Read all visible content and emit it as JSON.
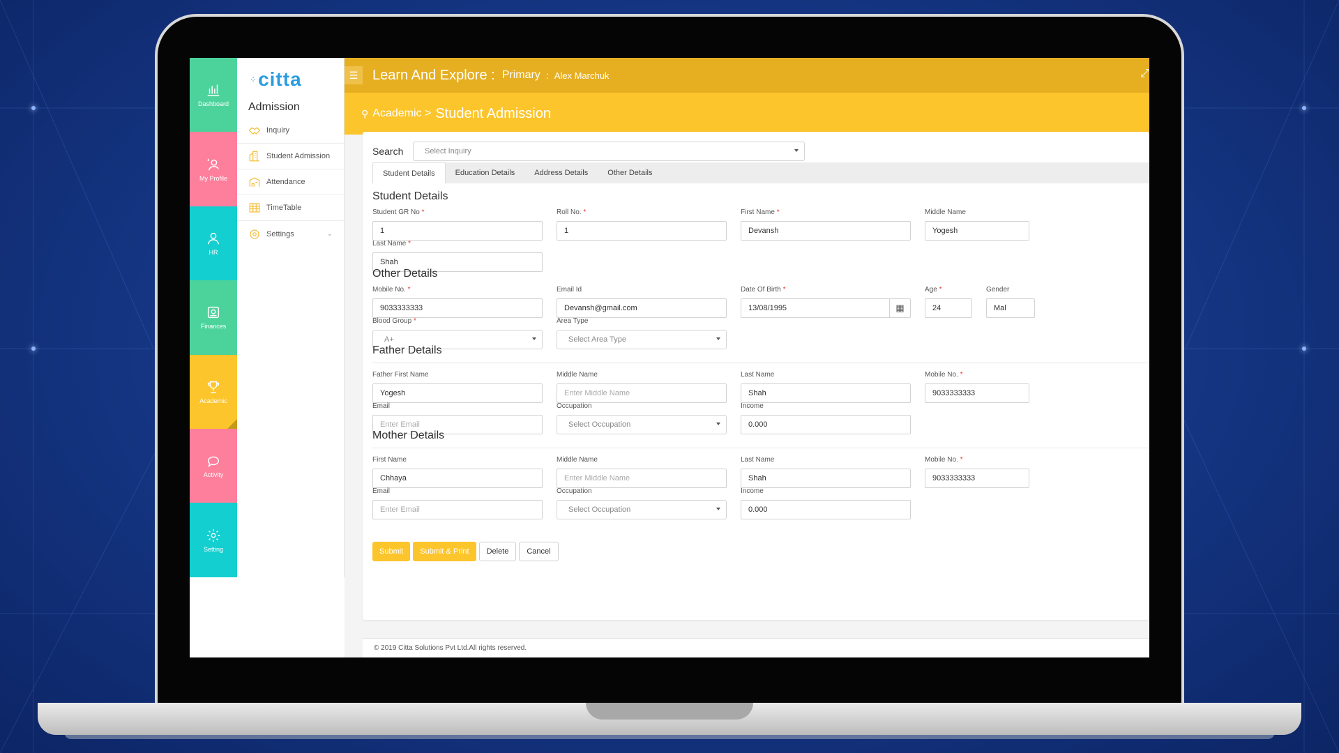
{
  "rail": [
    {
      "label": "Dashboard",
      "icon": "bar-chart-icon",
      "color": "#4cd39b"
    },
    {
      "label": "My Profile",
      "icon": "profile-icon",
      "color": "#fd7f9c"
    },
    {
      "label": "HR",
      "icon": "person-icon",
      "color": "#13cfd0"
    },
    {
      "label": "Finances",
      "icon": "finance-icon",
      "color": "#4cd39b"
    },
    {
      "label": "Academic",
      "icon": "trophy-icon",
      "color": "#fcc52c"
    },
    {
      "label": "Activity",
      "icon": "chat-icon",
      "color": "#fd7f9c"
    },
    {
      "label": "Setting",
      "icon": "gear-icon",
      "color": "#13cfd0"
    }
  ],
  "logo": {
    "text": "citta"
  },
  "submenu": {
    "title": "Admission",
    "items": [
      {
        "label": "Inquiry",
        "icon": "handshake-icon"
      },
      {
        "label": "Student Admission",
        "icon": "building-icon"
      },
      {
        "label": "Attendance",
        "icon": "attendance-icon"
      },
      {
        "label": "TimeTable",
        "icon": "table-icon"
      },
      {
        "label": "Settings",
        "icon": "gear-icon"
      }
    ]
  },
  "topbar": {
    "title": "Learn And Explore :",
    "school": "Primary",
    "sep": ":",
    "user": "Alex Marchuk"
  },
  "breadcrumb": {
    "parent": "Academic >",
    "current": "Student Admission"
  },
  "search": {
    "label": "Search",
    "placeholder": "Select Inquiry"
  },
  "tabs": [
    "Student Details",
    "Education Details",
    "Address Details",
    "Other Details"
  ],
  "sections": {
    "student": "Student Details",
    "other": "Other Details",
    "father": "Father Details",
    "mother": "Mother Details"
  },
  "student": {
    "gr_label": "Student GR No",
    "gr": "1",
    "roll_label": "Roll No.",
    "roll": "1",
    "first_label": "First Name",
    "first": "Devansh",
    "middle_label": "Middle Name",
    "middle": "Yogesh",
    "last_label": "Last Name",
    "last": "Shah"
  },
  "other": {
    "mobile_label": "Mobile No.",
    "mobile": "9033333333",
    "email_label": "Email Id",
    "email": "Devansh@gmail.com",
    "dob_label": "Date Of Birth",
    "dob": "13/08/1995",
    "age_label": "Age",
    "age": "24",
    "gender_label": "Gender",
    "gender": "Mal",
    "blood_label": "Blood Group",
    "blood": "A+",
    "area_label": "Area Type",
    "area": "Select Area Type"
  },
  "father": {
    "first_label": "Father First Name",
    "first": "Yogesh",
    "middle_label": "Middle Name",
    "middle_ph": "Enter Middle Name",
    "last_label": "Last Name",
    "last": "Shah",
    "mobile_label": "Mobile No.",
    "mobile": "9033333333",
    "email_label": "Email",
    "email_ph": "Enter Email",
    "occ_label": "Occupation",
    "occ": "Select Occupation",
    "income_label": "Income",
    "income": "0.000"
  },
  "mother": {
    "first_label": "First Name",
    "first": "Chhaya",
    "middle_label": "Middle Name",
    "middle_ph": "Enter Middle Name",
    "last_label": "Last Name",
    "last": "Shah",
    "mobile_label": "Mobile No.",
    "mobile": "9033333333",
    "email_label": "Email",
    "email_ph": "Enter Email",
    "occ_label": "Occupation",
    "occ": "Select Occupation",
    "income_label": "Income",
    "income": "0.000"
  },
  "buttons": {
    "submit": "Submit",
    "submit_print": "Submit & Print",
    "delete": "Delete",
    "cancel": "Cancel"
  },
  "required_mark": "*",
  "footer": "© 2019 Citta Solutions Pvt Ltd.All rights reserved."
}
